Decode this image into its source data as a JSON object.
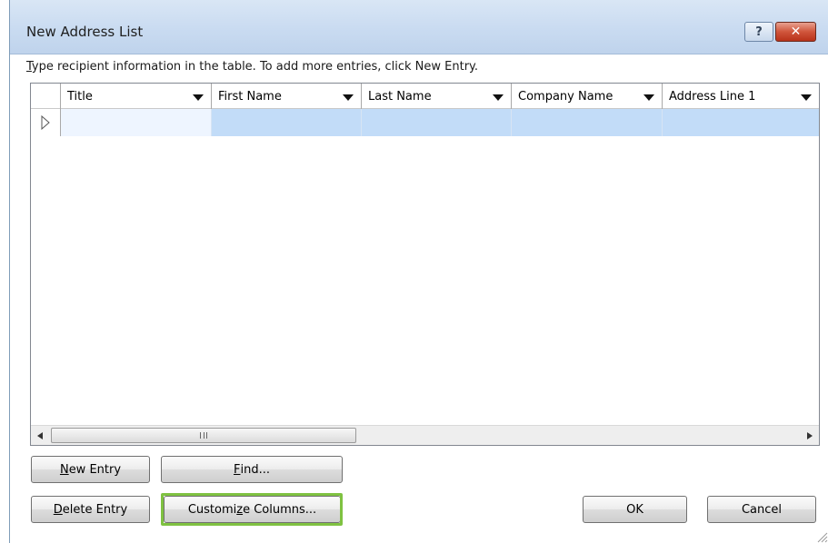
{
  "window": {
    "title": "New Address List",
    "help_label": "?",
    "close_label": "✕"
  },
  "instruction": {
    "prefix": "T",
    "text": "ype recipient information in the table.  To add more entries, click New Entry."
  },
  "table": {
    "columns": [
      {
        "label": "Title"
      },
      {
        "label": "First Name"
      },
      {
        "label": "Last Name"
      },
      {
        "label": "Company Name"
      },
      {
        "label": "Address Line 1"
      }
    ],
    "rows": [
      {
        "cells": [
          "",
          "",
          "",
          "",
          ""
        ],
        "current": true
      }
    ]
  },
  "buttons": {
    "new_entry": {
      "mnemonic": "N",
      "rest": "ew Entry"
    },
    "find": {
      "mnemonic": "F",
      "rest": "ind..."
    },
    "delete_entry": {
      "mnemonic": "D",
      "rest": "elete Entry"
    },
    "customize_columns": {
      "before": "Customi",
      "mnemonic": "z",
      "after": "e Columns..."
    },
    "ok": "OK",
    "cancel": "Cancel"
  },
  "colors": {
    "selected_row": "#c2dcf8",
    "highlight": "#7fc241",
    "title_bar": "#c9dbf1"
  },
  "icons": [
    "help-icon",
    "close-icon",
    "row-pointer-icon",
    "dropdown-arrow-icon",
    "scroll-left-icon",
    "scroll-right-icon",
    "resize-grip-icon"
  ]
}
